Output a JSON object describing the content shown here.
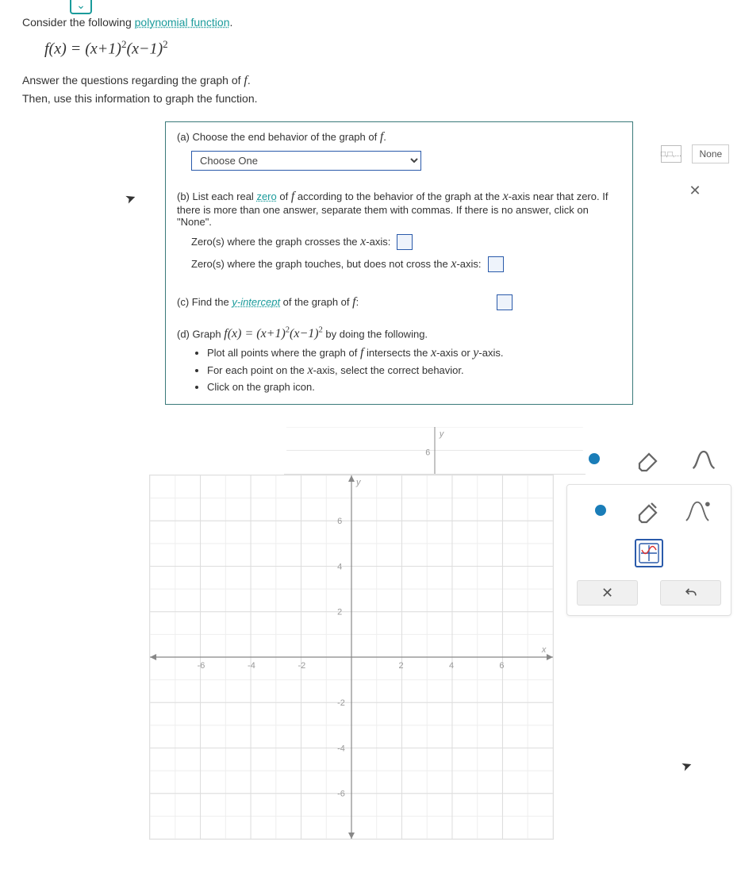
{
  "intro": {
    "prefix": "Consider the following ",
    "link": "polynomial function",
    "suffix": "."
  },
  "formula_html": "f(x) = (x+1)<span class='sup'>2</span>(x−1)<span class='sup'>2</span>",
  "instr1": "Answer the questions regarding the graph of ",
  "instr1_f": "f",
  "instr1_end": ".",
  "instr2": "Then, use this information to graph the function.",
  "a": {
    "label": "(a) Choose the end behavior of the graph of ",
    "select_placeholder": "Choose One"
  },
  "b": {
    "label_pre": "(b) List each real ",
    "zero_link": "zero",
    "label_mid": " of ",
    "label_post": " according to the behavior of the graph at the ",
    "xaxis": "x",
    "label_tail": "-axis near that zero. If there is more than one answer, separate them with commas. If there is no answer, click on \"None\".",
    "cross": "Zero(s) where the graph crosses the ",
    "cross_tail": "-axis:",
    "touch": "Zero(s) where the graph touches, but does not cross the ",
    "touch_tail": "-axis:"
  },
  "c": {
    "pre": "(c) Find the ",
    "ylink": "y-intercept",
    "post": " of the graph of ",
    "end": ":"
  },
  "d": {
    "label": "(d) Graph ",
    "formula": "f(x) = (x+1)<span class='sup'>2</span>(x−1)<span class='sup'>2</span>",
    "post": " by doing the following.",
    "li1_pre": "Plot all points where the graph of ",
    "li1_post": " intersects the ",
    "li1_or": "-axis or ",
    "li1_end": "-axis.",
    "li2_pre": "For each point on the ",
    "li2_post": "-axis, select the correct behavior.",
    "li3": "Click on the graph icon."
  },
  "side": {
    "none": "None",
    "box1": "□,□,...",
    "x": "✕"
  },
  "tools": {
    "x": "✕",
    "undo": "↶"
  },
  "chart_data": {
    "type": "scatter",
    "title": "",
    "xlabel": "x",
    "ylabel": "y",
    "xlim": [
      -8,
      8
    ],
    "ylim": [
      -8,
      8
    ],
    "xticks": [
      -6,
      -4,
      -2,
      2,
      4,
      6
    ],
    "yticks": [
      -6,
      -4,
      -2,
      2,
      4,
      6
    ],
    "series": []
  }
}
